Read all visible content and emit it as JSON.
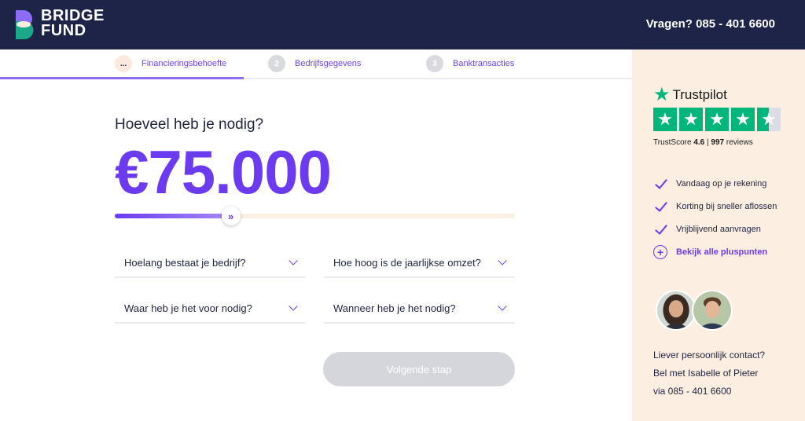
{
  "header": {
    "logo_line1": "BRIDGE",
    "logo_line2": "FUND",
    "contact": "Vragen? 085 - 401 6600"
  },
  "stepper": {
    "steps": [
      {
        "badge": "...",
        "label": "Financieringsbehoefte",
        "active": true
      },
      {
        "badge": "2",
        "label": "Bedrijfsgegevens",
        "active": false
      },
      {
        "badge": "3",
        "label": "Banktransacties",
        "active": false
      }
    ]
  },
  "main": {
    "question": "Hoeveel heb je nodig?",
    "amount": "€75.000",
    "slider_fraction": 0.29,
    "slider_icon": "double-chevron-right-icon",
    "selects": [
      {
        "label": "Hoelang bestaat je bedrijf?"
      },
      {
        "label": "Hoe hoog is de jaarlijkse omzet?"
      },
      {
        "label": "Waar heb je het voor nodig?"
      },
      {
        "label": "Wanneer heb je het nodig?"
      }
    ],
    "next_button": "Volgende stap"
  },
  "sidebar": {
    "trustpilot": {
      "name": "Trustpilot",
      "trustscore_label": "TrustScore",
      "trustscore": "4.6",
      "separator": "|",
      "reviews_count": "997",
      "reviews_label": "reviews",
      "stars": 4.5
    },
    "perks": [
      {
        "label": "Vandaag op je rekening"
      },
      {
        "label": "Korting bij sneller aflossen"
      },
      {
        "label": "Vrijblijvend aanvragen"
      }
    ],
    "perks_link": "Bekijk alle pluspunten",
    "contact_lines": [
      "Liever persoonlijk contact?",
      "Bel met Isabelle of Pieter",
      "via 085 - 401 6600"
    ]
  },
  "colors": {
    "navy": "#1e2448",
    "purple": "#6c3aef",
    "cream": "#fcefe2",
    "trustpilot_green": "#00b67a"
  }
}
